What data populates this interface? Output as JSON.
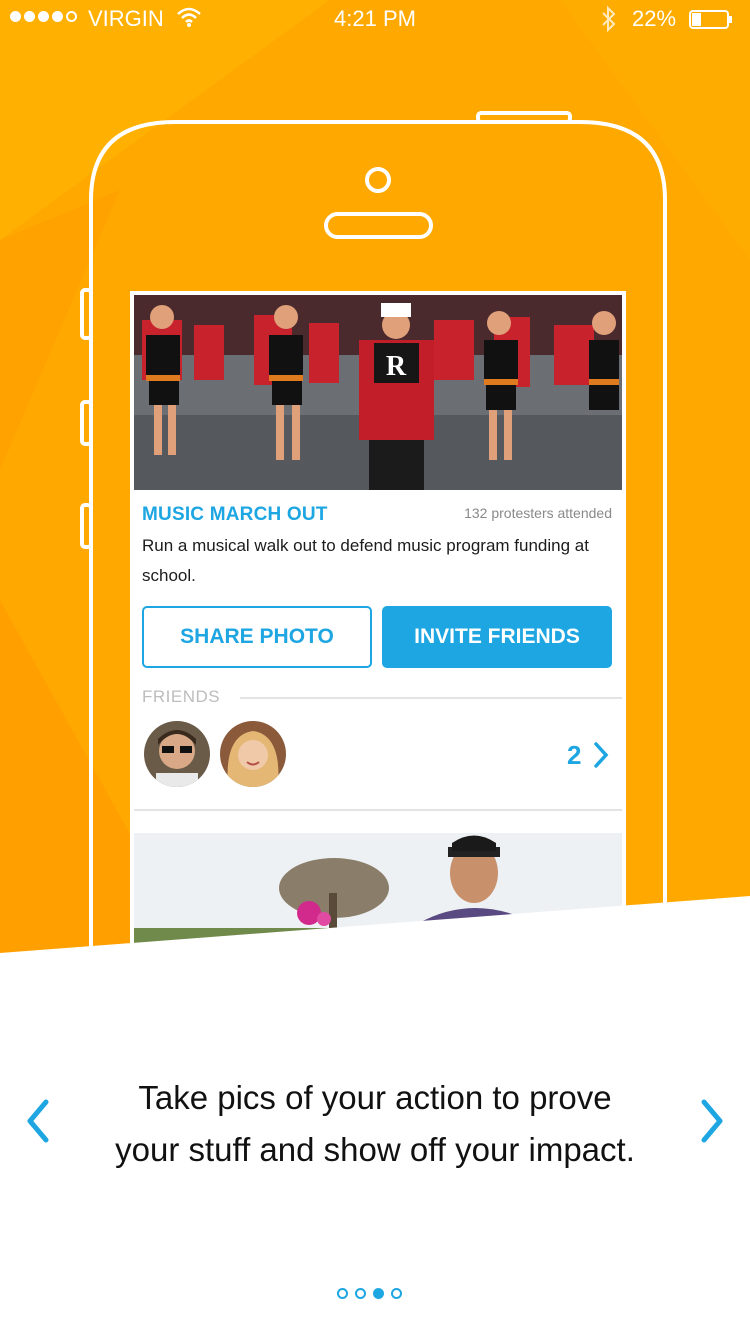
{
  "status_bar": {
    "carrier": "VIRGIN",
    "time": "4:21 PM",
    "battery": "22%",
    "signal_bars_filled": 4,
    "signal_bars_total": 5
  },
  "card": {
    "title": "MUSIC MARCH OUT",
    "attended": "132 protesters attended",
    "description": "Run a musical walk out to defend music program funding at school.",
    "share_button": "SHARE PHOTO",
    "invite_button": "INVITE FRIENDS",
    "friends_label": "FRIENDS",
    "friends_count": "2"
  },
  "onboarding": {
    "caption_line1": "Take pics of your action to prove",
    "caption_line2": "your stuff and show off your impact.",
    "page_count": 4,
    "current_page": 3
  },
  "colors": {
    "background": "#FFA800",
    "accent": "#1DA6E2"
  }
}
